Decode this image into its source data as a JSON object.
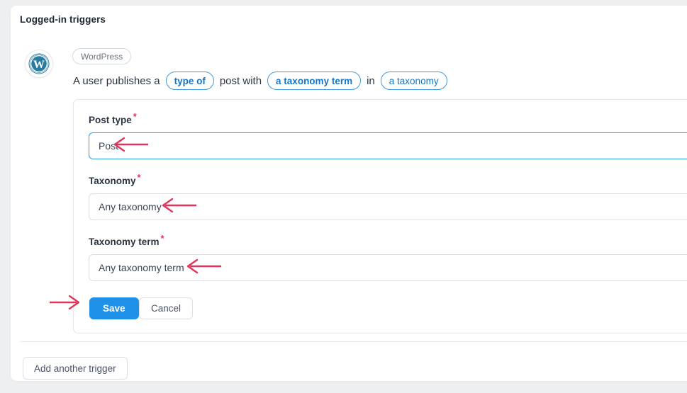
{
  "page": {
    "background_color": "#eeeff1",
    "card_title": "Logged-in triggers"
  },
  "trigger": {
    "avatar_icon": "wordpress-logo-icon",
    "integration_label": "WordPress",
    "sentence": {
      "part1": "A user publishes a",
      "token_post_type": "type of",
      "part2": "post with",
      "token_taxonomy_term": "a taxonomy term",
      "part3": "in",
      "token_taxonomy": "a taxonomy"
    }
  },
  "form": {
    "fields": [
      {
        "label": "Post type",
        "required_marker": "*",
        "value": "Post",
        "focused": true
      },
      {
        "label": "Taxonomy",
        "required_marker": "*",
        "value": "Any taxonomy",
        "focused": false
      },
      {
        "label": "Taxonomy term",
        "required_marker": "*",
        "value": "Any taxonomy term",
        "focused": false
      }
    ],
    "save_label": "Save",
    "cancel_label": "Cancel"
  },
  "footer": {
    "add_trigger_label": "Add another trigger"
  },
  "annotations": {
    "arrow_color": "#e0355a",
    "arrows": [
      {
        "name": "arrow-to-post-type-field",
        "direction": "left"
      },
      {
        "name": "arrow-to-taxonomy-field",
        "direction": "left"
      },
      {
        "name": "arrow-to-taxonomy-term-field",
        "direction": "left"
      },
      {
        "name": "arrow-to-save-button",
        "direction": "right"
      }
    ]
  },
  "colors": {
    "primary_blue": "#1e90e8",
    "token_blue": "#1476c4",
    "focus_blue": "#2f9ce0",
    "wordpress_teal": "#2a7ba0",
    "required_red": "#e0355a"
  }
}
